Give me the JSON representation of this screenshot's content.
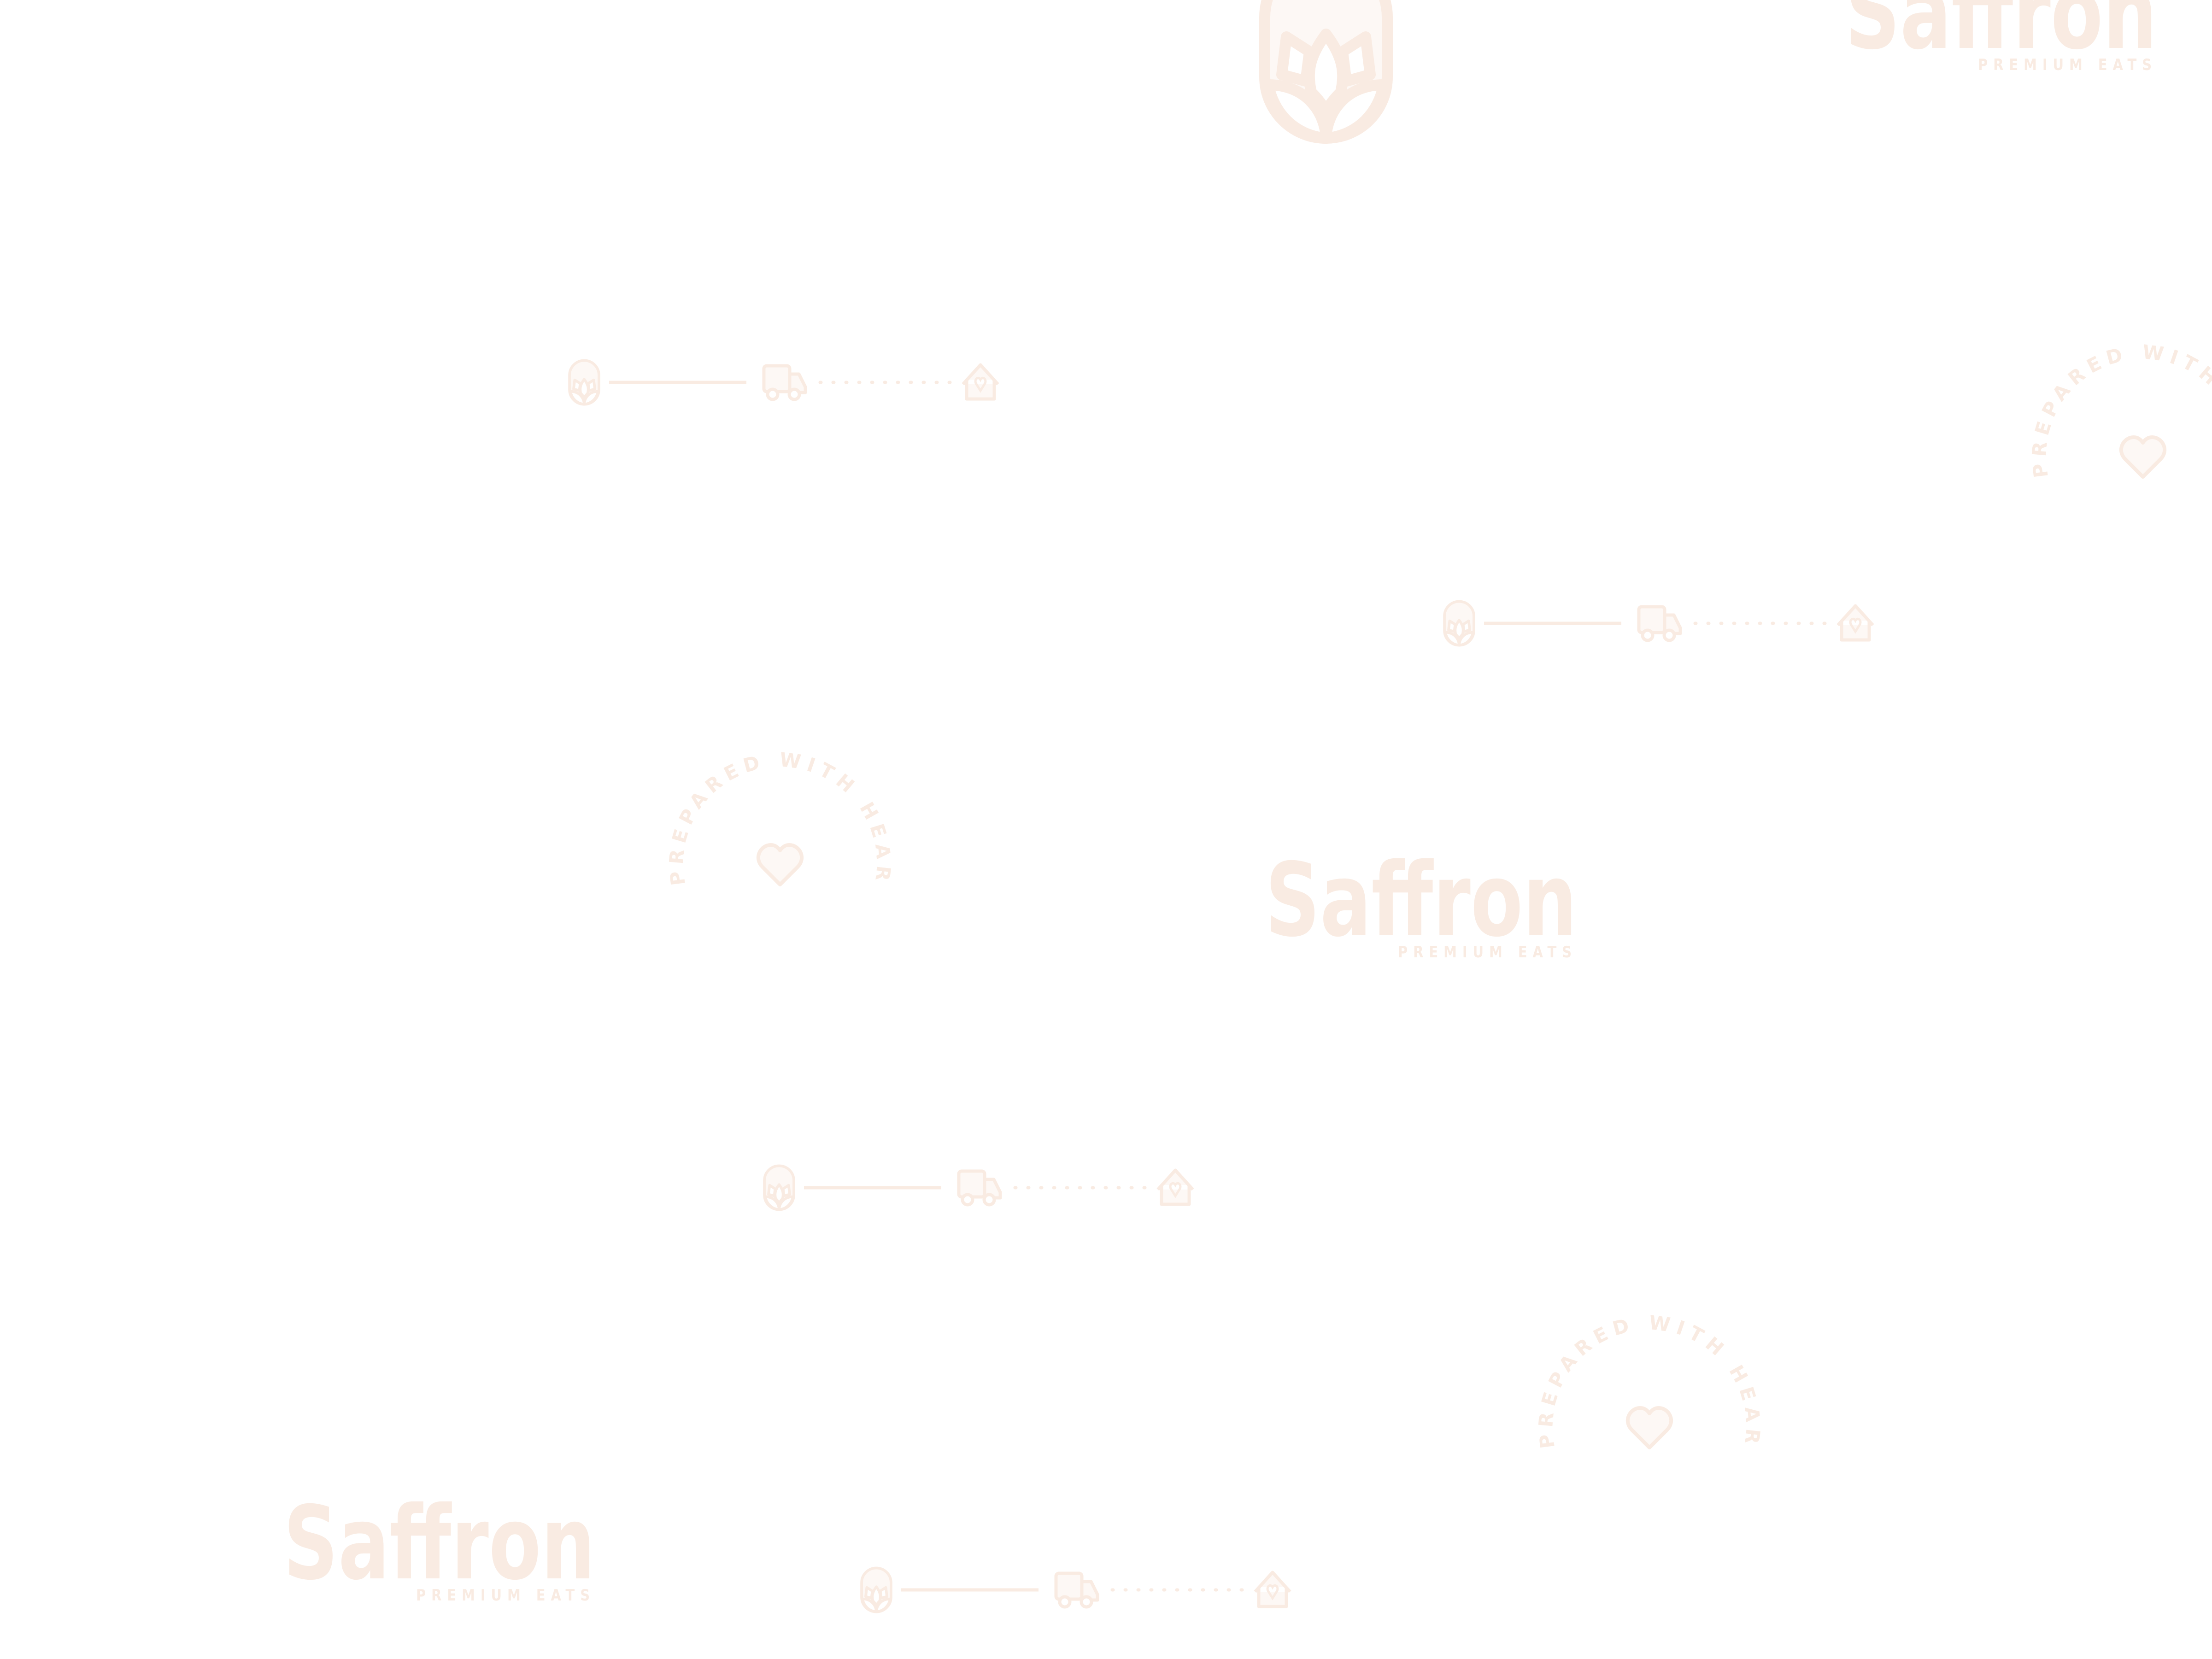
{
  "brand": {
    "name": "Saffron",
    "tagline": "PREMIUM EATS",
    "stamp_text": "PREPARED WITH HEART",
    "colors": {
      "pattern": "#f9ebe2",
      "pattern_fill": "#fdf8f5",
      "background": "#ffffff"
    }
  },
  "icons": [
    "lotus-badge-icon",
    "truck-icon",
    "house-heart-icon",
    "heart-icon"
  ]
}
